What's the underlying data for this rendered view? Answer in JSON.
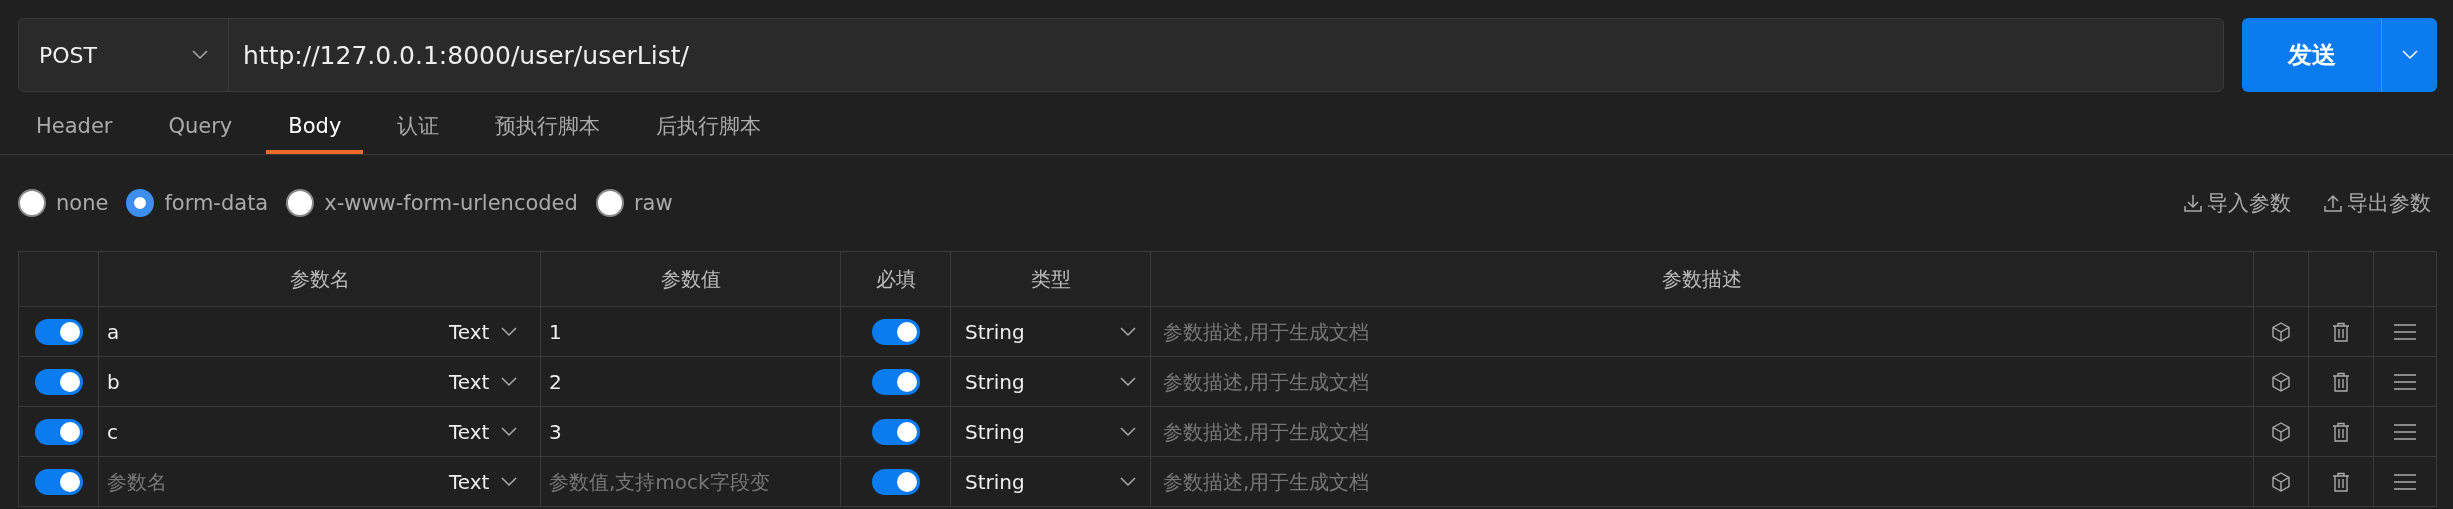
{
  "request": {
    "method": "POST",
    "url": "http://127.0.0.1:8000/user/userList/",
    "send_label": "发送"
  },
  "tabs": [
    {
      "label": "Header",
      "selected": false
    },
    {
      "label": "Query",
      "selected": false
    },
    {
      "label": "Body",
      "selected": true
    },
    {
      "label": "认证",
      "selected": false
    },
    {
      "label": "预执行脚本",
      "selected": false
    },
    {
      "label": "后执行脚本",
      "selected": false
    }
  ],
  "body_types": [
    {
      "label": "none",
      "selected": false
    },
    {
      "label": "form-data",
      "selected": true
    },
    {
      "label": "x-www-form-urlencoded",
      "selected": false
    },
    {
      "label": "raw",
      "selected": false
    }
  ],
  "actions": [
    {
      "kind": "import",
      "label": "导入参数"
    },
    {
      "kind": "export",
      "label": "导出参数"
    }
  ],
  "table": {
    "columns": [
      "参数名",
      "参数值",
      "必填",
      "类型",
      "参数描述"
    ],
    "rows": [
      {
        "enabled": true,
        "name": "a",
        "name_type": "Text",
        "value": "1",
        "required": true,
        "type": "String",
        "description_placeholder": "参数描述,用于生成文档"
      },
      {
        "enabled": true,
        "name": "b",
        "name_type": "Text",
        "value": "2",
        "required": true,
        "type": "String",
        "description_placeholder": "参数描述,用于生成文档"
      },
      {
        "enabled": true,
        "name": "c",
        "name_type": "Text",
        "value": "3",
        "required": true,
        "type": "String",
        "description_placeholder": "参数描述,用于生成文档"
      },
      {
        "enabled": true,
        "name_placeholder": "参数名",
        "name_type": "Text",
        "value_placeholder": "参数值,支持mock字段变",
        "required": true,
        "type": "String",
        "description_placeholder": "参数描述,用于生成文档"
      }
    ]
  }
}
